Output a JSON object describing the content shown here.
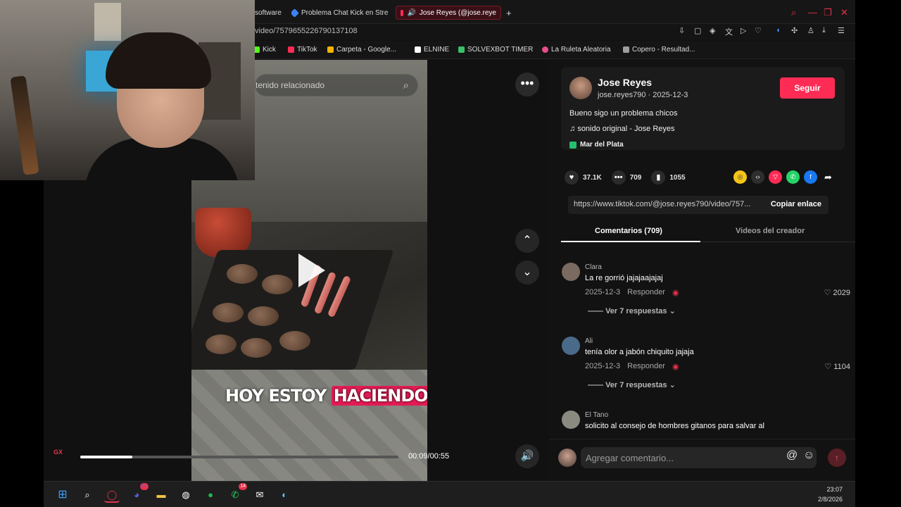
{
  "browser": {
    "tabs": [
      {
        "label": "software"
      },
      {
        "label": "Problema Chat Kick en Stre"
      },
      {
        "label": "Jose Reyes (@jose.reye"
      }
    ],
    "new_tab": "+",
    "url": "video/7579655226790137108",
    "bookmarks": [
      {
        "label": "Kick",
        "color": "#53fc18"
      },
      {
        "label": "TikTok",
        "color": "#fe2c55"
      },
      {
        "label": "Carpeta - Google...",
        "color": "#f4b400"
      },
      {
        "label": "ELNINE",
        "color": "#ffffff"
      },
      {
        "label": "SOLVEXBOT TIMER",
        "color": "#3bbf6b"
      },
      {
        "label": "La Ruleta Aleatoria",
        "color": "#e84e8a"
      },
      {
        "label": "Copero - Resultad...",
        "color": "#9e9e9e"
      }
    ]
  },
  "video": {
    "search_placeholder": "tenido relacionado",
    "caption_plain": "HOY ESTOY",
    "caption_highlight": "HACIENDO",
    "time": "00:09/00:55",
    "progress_fraction": 0.164,
    "gx_label": "GX"
  },
  "post": {
    "author": "Jose Reyes",
    "handle_date": "jose.reyes790 · 2025-12-3",
    "follow_label": "Seguir",
    "description": "Bueno sigo un problema chicos",
    "music": "sonido original - Jose Reyes",
    "location": "Mar del Plata",
    "likes": "37.1K",
    "comments": "709",
    "saves": "1055",
    "link": "https://www.tiktok.com/@jose.reyes790/video/757...",
    "copy_label": "Copiar enlace"
  },
  "tabs": {
    "comments": "Comentarios (709)",
    "creator_videos": "Videos del creador"
  },
  "comments": [
    {
      "user": "Clara",
      "text": "La re gorrió jajajaajajaj",
      "date": "2025-12-3",
      "reply": "Responder",
      "likes": "2029",
      "replies": "Ver 7 respuestas",
      "avatar": "#7a6a60"
    },
    {
      "user": "Ali",
      "text": "tenía olor a jabón chiquito jajaja",
      "date": "2025-12-3",
      "reply": "Responder",
      "likes": "1104",
      "replies": "Ver 7 respuestas",
      "avatar": "#4a6a8a"
    },
    {
      "user": "El Tano",
      "text": "solicito al consejo de hombres gitanos para salvar al",
      "avatar": "#8a8a80"
    }
  ],
  "comment_bar": {
    "placeholder": "Agregar comentario..."
  },
  "taskbar": {
    "time": "23:07",
    "date": "2/8/2026",
    "badges": {
      "discord": "9+",
      "whatsapp": "14"
    }
  }
}
